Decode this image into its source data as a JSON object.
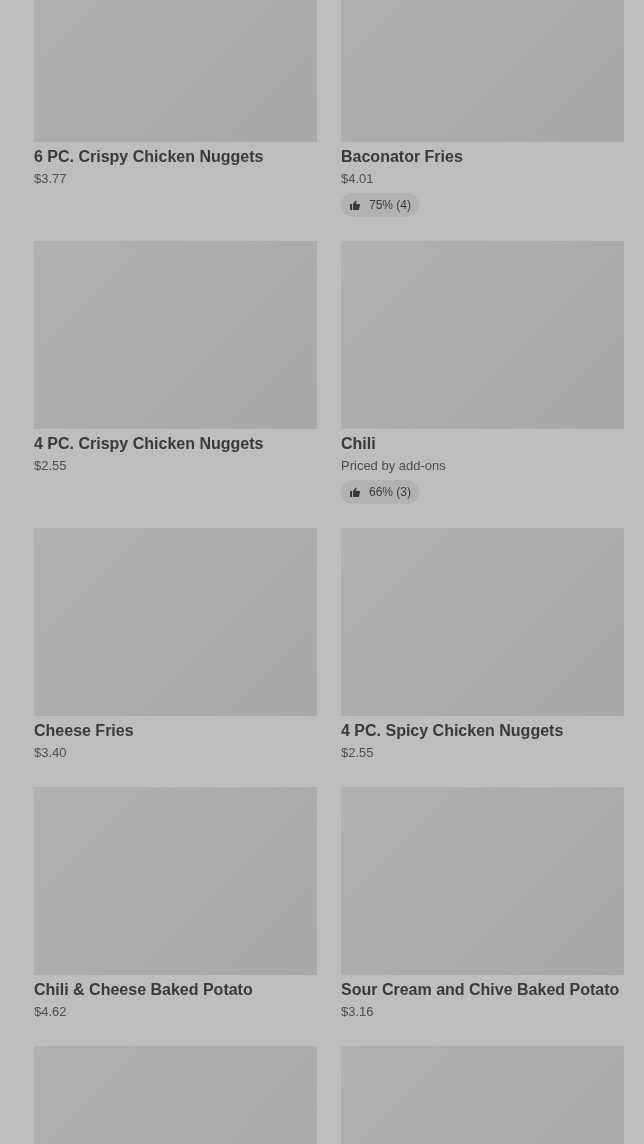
{
  "menu_items": [
    {
      "kind": "full",
      "name": "6 PC. Crispy Chicken Nuggets",
      "price": "$3.77"
    },
    {
      "kind": "full",
      "name": "Baconator Fries",
      "price": "$4.01",
      "rating": "75% (4)"
    },
    {
      "kind": "full",
      "name": "4 PC. Crispy Chicken Nuggets",
      "price": "$2.55"
    },
    {
      "kind": "full",
      "name": "Chili",
      "price": "Priced by add-ons",
      "rating": "66% (3)"
    },
    {
      "kind": "full",
      "name": "Cheese Fries",
      "price": "$3.40"
    },
    {
      "kind": "full",
      "name": "4 PC. Spicy Chicken Nuggets",
      "price": "$2.55"
    },
    {
      "kind": "full",
      "name": "Chili & Cheese Baked Potato",
      "price": "$4.62"
    },
    {
      "kind": "full",
      "name": "Sour Cream and Chive Baked Potato",
      "price": "$3.16"
    },
    {
      "kind": "image_only"
    },
    {
      "kind": "image_only"
    }
  ]
}
